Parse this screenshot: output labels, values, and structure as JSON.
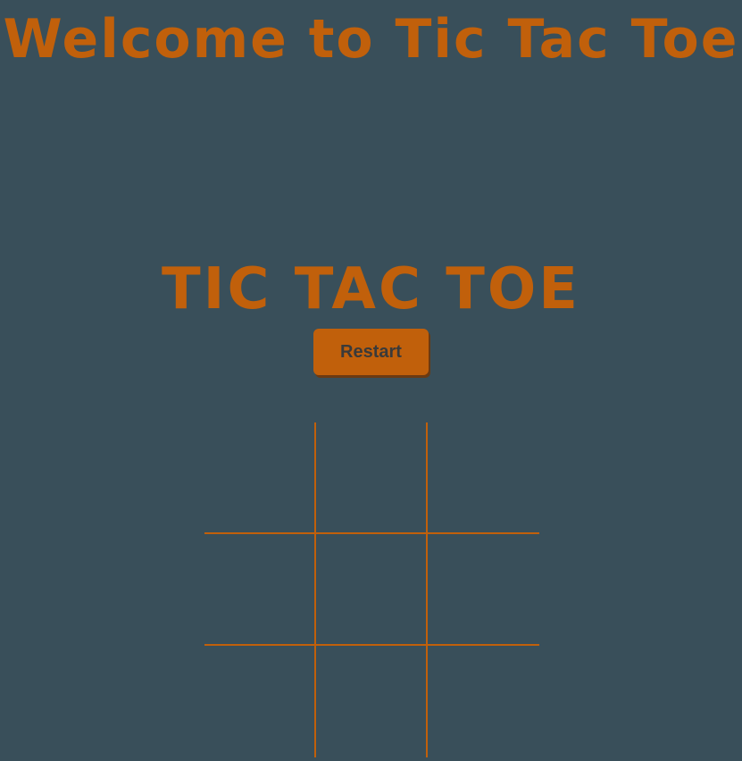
{
  "header": {
    "welcome_text": "Welcome to Tic Tac Toe"
  },
  "game": {
    "title": "TIC TAC TOE",
    "restart_label": "Restart",
    "board": [
      "",
      "",
      "",
      "",
      "",
      "",
      "",
      "",
      ""
    ]
  },
  "colors": {
    "background": "#394f5a",
    "accent": "#c1600b",
    "button_text": "#3a3a3a"
  }
}
